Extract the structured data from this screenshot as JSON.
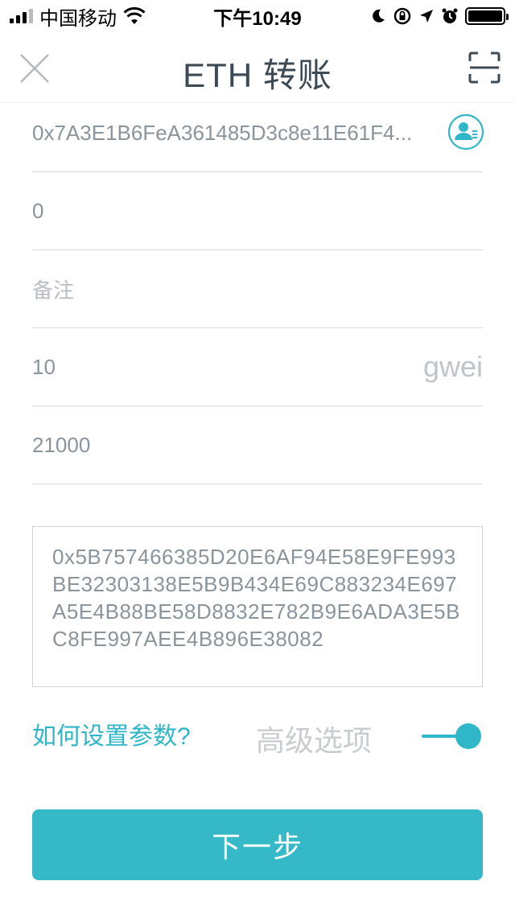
{
  "status_bar": {
    "carrier": "中国移动",
    "time": "下午10:49"
  },
  "header": {
    "title": "ETH 转账"
  },
  "form": {
    "address": "0x7A3E1B6FeA361485D3c8e11E61F4...",
    "amount": "0",
    "note_placeholder": "备注",
    "gas_price": "10",
    "gas_price_unit": "gwei",
    "gas_limit": "21000",
    "data": "0x5B757466385D20E6AF94E58E9FE993BE32303138E5B9B434E69C883234E697A5E4B88BE58D8832E782B9E6ADA3E5BC8FE997AEE4B896E38082"
  },
  "options": {
    "help_link": "如何设置参数?",
    "advanced_label": "高级选项",
    "advanced_enabled": true
  },
  "next_button": "下一步",
  "colors": {
    "accent": "#35b8c8",
    "title": "#3c4a55",
    "text": "#8a949c"
  }
}
